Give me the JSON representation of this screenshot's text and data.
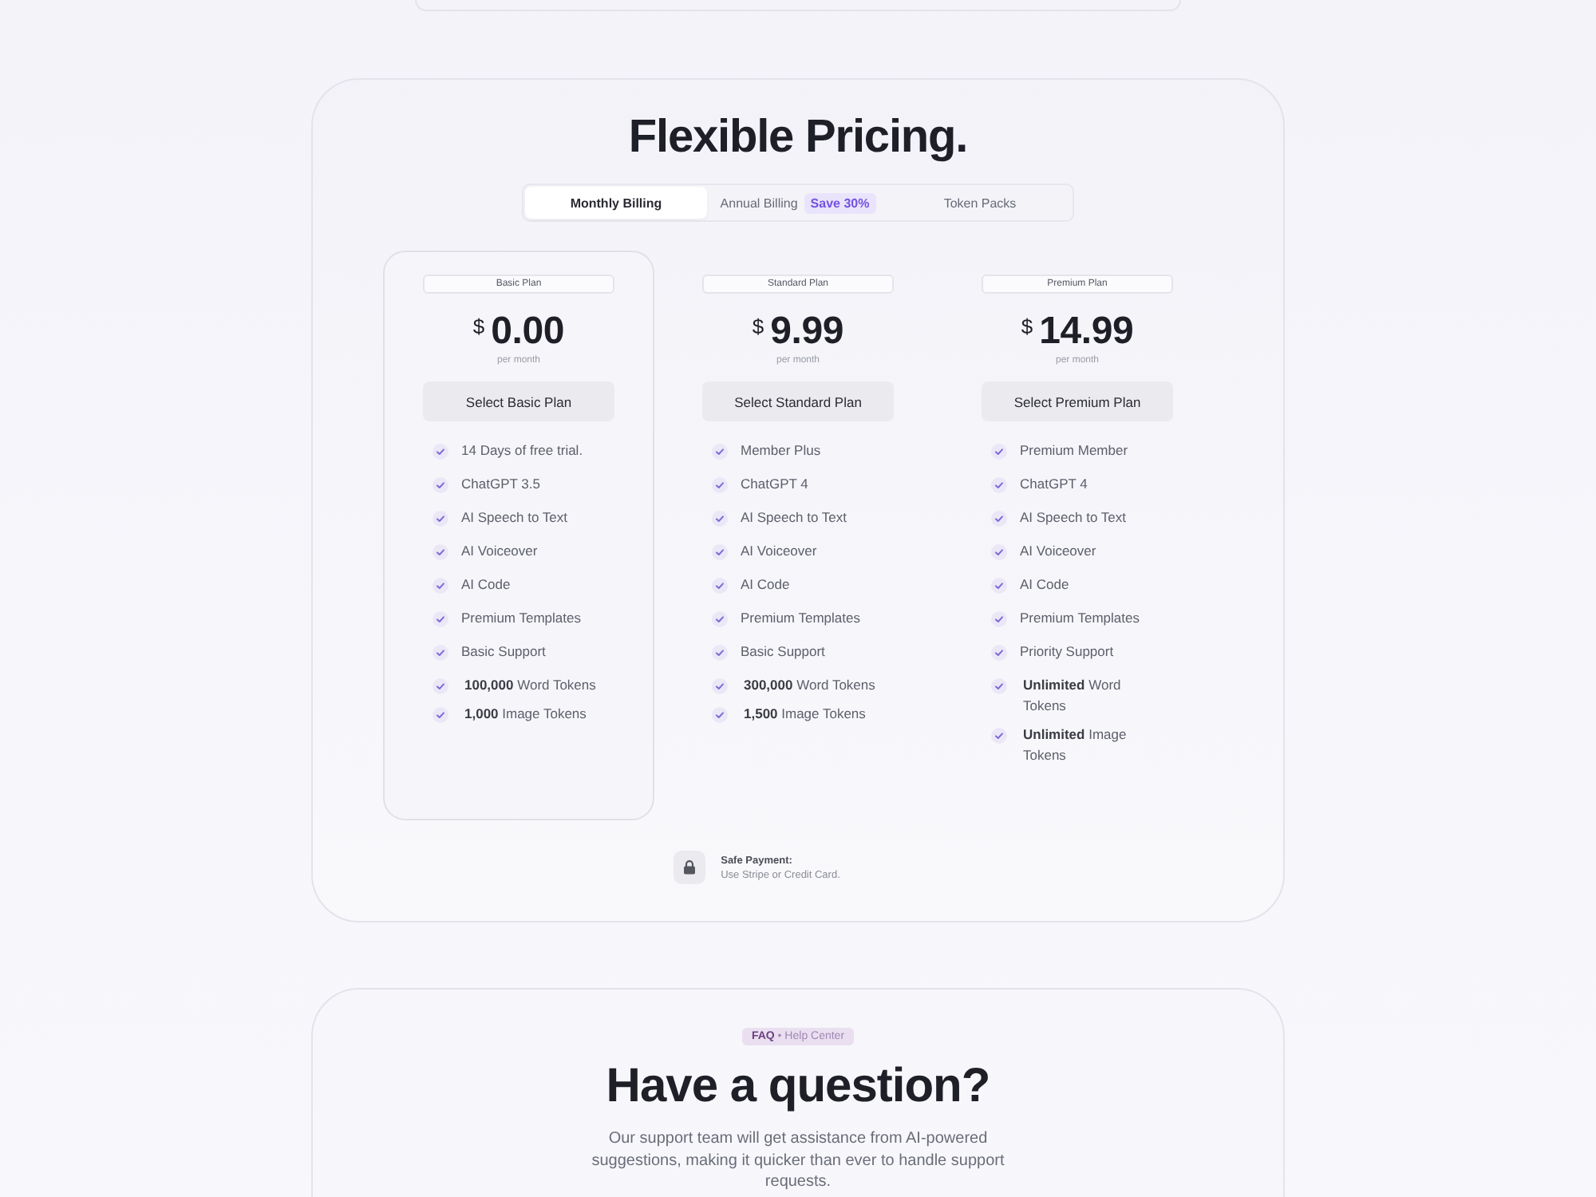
{
  "title": "Flexible Pricing.",
  "billing_tabs": [
    {
      "label": "Monthly Billing",
      "selected": true
    },
    {
      "label": "Annual Billing",
      "badge": "Save 30%",
      "selected": false
    },
    {
      "label": "Token Packs",
      "selected": false
    }
  ],
  "plans": [
    {
      "name": "Basic Plan",
      "currency": "$",
      "price": "0.00",
      "period": "per month",
      "button": "Select Basic Plan",
      "selected": true,
      "features": [
        {
          "kind": "feature",
          "text": "14 Days of free trial."
        },
        {
          "kind": "feature",
          "text": "ChatGPT 3.5"
        },
        {
          "kind": "feature",
          "text": "AI Speech to Text"
        },
        {
          "kind": "feature",
          "text": "AI Voiceover"
        },
        {
          "kind": "feature",
          "text": "AI Code"
        },
        {
          "kind": "feature",
          "text": "Premium Templates"
        },
        {
          "kind": "feature",
          "text": "Basic Support"
        },
        {
          "kind": "token",
          "text": "**100,000** Word Tokens"
        },
        {
          "kind": "token",
          "text": "**1,000** Image Tokens"
        }
      ]
    },
    {
      "name": "Standard Plan",
      "currency": "$",
      "price": "9.99",
      "period": "per month",
      "button": "Select Standard Plan",
      "selected": false,
      "features": [
        {
          "kind": "feature",
          "text": "Member Plus"
        },
        {
          "kind": "feature",
          "text": "ChatGPT 4"
        },
        {
          "kind": "feature",
          "text": "AI Speech to Text"
        },
        {
          "kind": "feature",
          "text": "AI Voiceover"
        },
        {
          "kind": "feature",
          "text": "AI Code"
        },
        {
          "kind": "feature",
          "text": "Premium Templates"
        },
        {
          "kind": "feature",
          "text": "Basic Support"
        },
        {
          "kind": "token",
          "text": "**300,000** Word Tokens"
        },
        {
          "kind": "token",
          "text": "**1,500** Image Tokens"
        }
      ]
    },
    {
      "name": "Premium Plan",
      "currency": "$",
      "price": "14.99",
      "period": "per month",
      "button": "Select Premium Plan",
      "selected": false,
      "features": [
        {
          "kind": "feature",
          "text": "Premium Member"
        },
        {
          "kind": "feature",
          "text": "ChatGPT 4"
        },
        {
          "kind": "feature",
          "text": "AI Speech to Text"
        },
        {
          "kind": "feature",
          "text": "AI Voiceover"
        },
        {
          "kind": "feature",
          "text": "AI Code"
        },
        {
          "kind": "feature",
          "text": "Premium Templates"
        },
        {
          "kind": "feature",
          "text": "Priority Support"
        },
        {
          "kind": "token",
          "text": "**Unlimited** Word Tokens"
        },
        {
          "kind": "token",
          "text": "**Unlimited** Image Tokens"
        }
      ]
    }
  ],
  "safe_payment": {
    "title": "Safe Payment:",
    "text": "Use Stripe or Credit Card."
  },
  "faq": {
    "badge": "**FAQ** • Help Center",
    "title": "Have a question?",
    "text": "Our support team will get assistance from AI-powered suggestions, making it quicker than ever to handle support requests."
  }
}
